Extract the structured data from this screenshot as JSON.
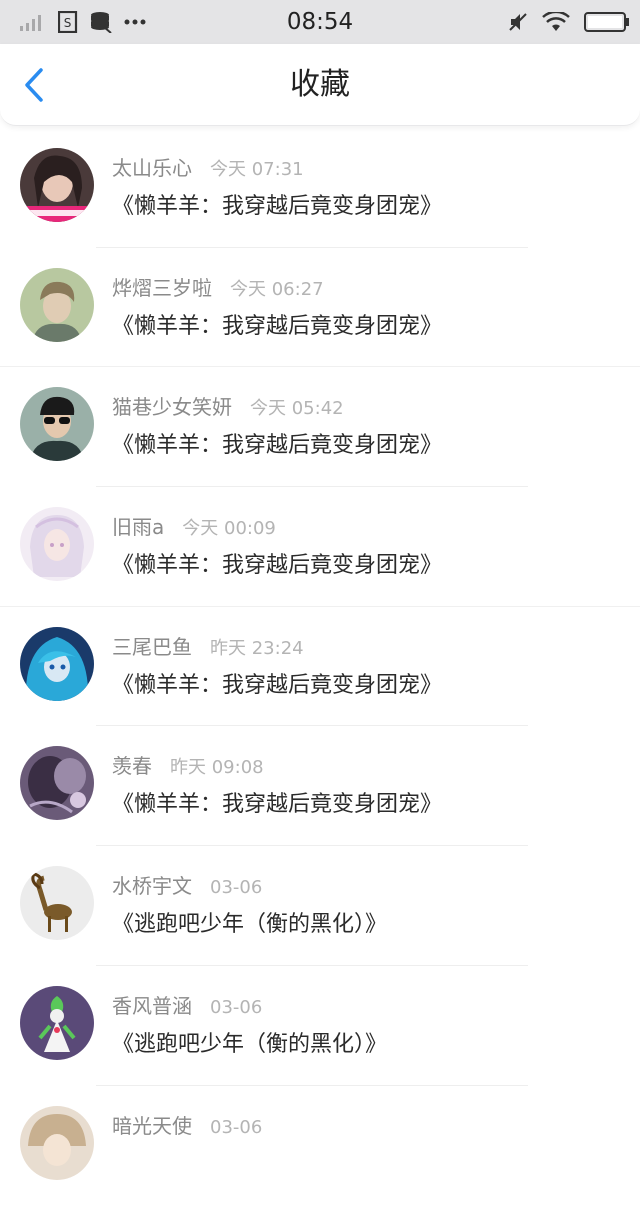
{
  "status_bar": {
    "time": "08:54",
    "icons_left": [
      "signal-icon",
      "sim-icon",
      "storage-icon",
      "more-dots-icon"
    ],
    "icons_right": [
      "mute-icon",
      "wifi-icon",
      "battery-icon"
    ]
  },
  "header": {
    "title": "收藏",
    "back_icon": "back-chevron-icon",
    "accent_color": "#2a8cf0"
  },
  "favorites": [
    {
      "user": "太山乐心",
      "time": "今天 07:31",
      "book": "《懒羊羊：我穿越后竟变身团宠》"
    },
    {
      "user": "烨熠三岁啦",
      "time": "今天 06:27",
      "book": "《懒羊羊：我穿越后竟变身团宠》"
    },
    {
      "user": "猫巷少女笑妍",
      "time": "今天 05:42",
      "book": "《懒羊羊：我穿越后竟变身团宠》"
    },
    {
      "user": "旧雨a",
      "time": "今天 00:09",
      "book": "《懒羊羊：我穿越后竟变身团宠》"
    },
    {
      "user": "三尾巴鱼",
      "time": "昨天 23:24",
      "book": "《懒羊羊：我穿越后竟变身团宠》"
    },
    {
      "user": "羡春",
      "time": "昨天 09:08",
      "book": "《懒羊羊：我穿越后竟变身团宠》"
    },
    {
      "user": "水桥宇文",
      "time": "03-06",
      "book": "《逃跑吧少年（衡的黑化）》"
    },
    {
      "user": "香风普涵",
      "time": "03-06",
      "book": "《逃跑吧少年（衡的黑化）》"
    },
    {
      "user": "暗光天使",
      "time": "03-06",
      "book": ""
    }
  ]
}
